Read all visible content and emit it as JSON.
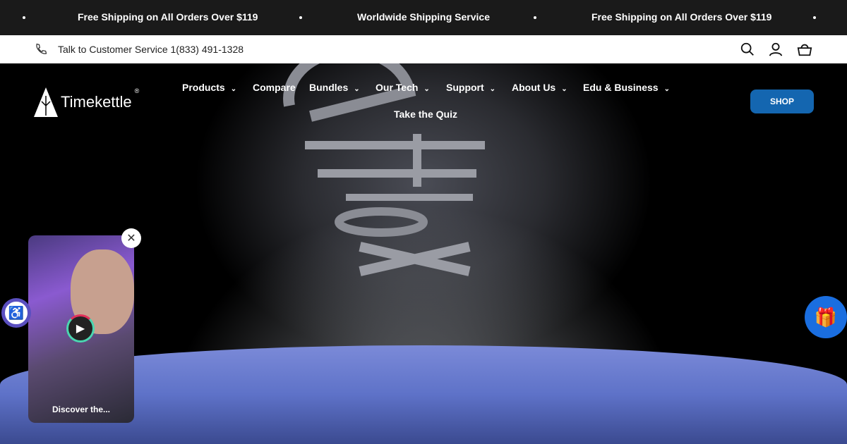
{
  "announcement": {
    "items": [
      "Free Shipping on All Orders Over $119",
      "Worldwide Shipping Service",
      "Free Shipping on All Orders Over $119"
    ]
  },
  "utility": {
    "phone_text": "Talk to Customer Service 1(833) 491-1328",
    "icons": [
      "phone-icon",
      "search-icon",
      "account-icon",
      "cart-icon"
    ]
  },
  "header": {
    "logo": "Timekettle",
    "logo_mark": "®",
    "nav": [
      {
        "label": "Products",
        "dropdown": true
      },
      {
        "label": "Compare",
        "dropdown": false
      },
      {
        "label": "Bundles",
        "dropdown": true
      },
      {
        "label": "Our Tech",
        "dropdown": true
      },
      {
        "label": "Support",
        "dropdown": true
      },
      {
        "label": "About Us",
        "dropdown": true
      },
      {
        "label": "Edu & Business",
        "dropdown": true
      },
      {
        "label": "Take the Quiz",
        "dropdown": false
      }
    ],
    "shop_label": "SHOP"
  },
  "video_widget": {
    "caption": "Discover the..."
  },
  "colors": {
    "shop": "#1466b0",
    "gift": "#1a6ee0",
    "accessibility": "#5a4fc0"
  }
}
